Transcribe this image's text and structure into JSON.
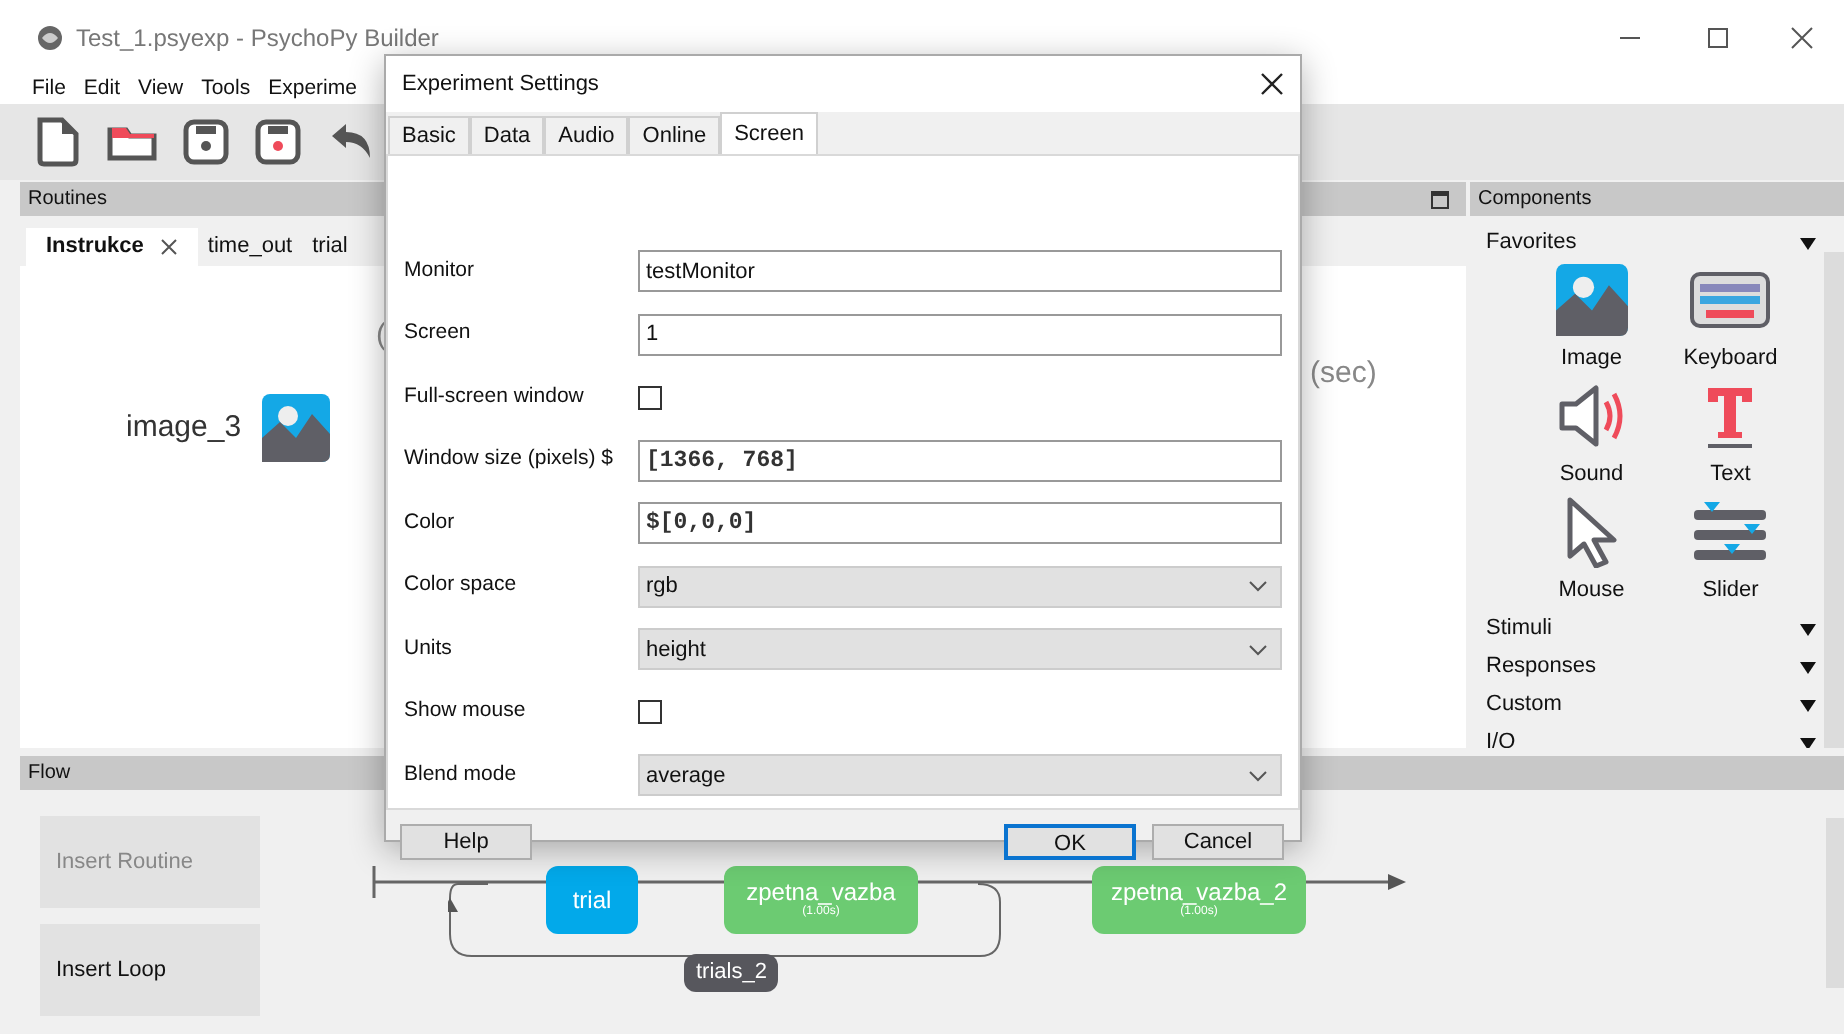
{
  "window": {
    "title": "Test_1.psyexp - PsychoPy Builder"
  },
  "menu": [
    "File",
    "Edit",
    "View",
    "Tools",
    "Experime"
  ],
  "routines": {
    "title": "Routines",
    "tabs": [
      {
        "label": "Instrukce",
        "selected": true
      },
      {
        "label": "time_out",
        "selected": false
      },
      {
        "label": "trial",
        "selected": false
      }
    ],
    "component_label": "image_3",
    "paren": "(",
    "unit": "(sec)"
  },
  "components": {
    "title": "Components",
    "categories": [
      {
        "label": "Favorites",
        "items": [
          {
            "label": "Image",
            "kind": "image"
          },
          {
            "label": "Keyboard",
            "kind": "keyboard"
          },
          {
            "label": "Sound",
            "kind": "sound"
          },
          {
            "label": "Text",
            "kind": "text"
          },
          {
            "label": "Mouse",
            "kind": "mouse"
          },
          {
            "label": "Slider",
            "kind": "slider"
          }
        ]
      },
      {
        "label": "Stimuli"
      },
      {
        "label": "Responses"
      },
      {
        "label": "Custom"
      },
      {
        "label": "I/O"
      }
    ]
  },
  "flow": {
    "title": "Flow",
    "buttons": [
      {
        "label": "Insert Routine",
        "disabled": true
      },
      {
        "label": "Insert Loop",
        "disabled": false
      }
    ],
    "routines": [
      {
        "label": "trial",
        "color": "#02a9ea"
      },
      {
        "label": "zpetna_vazba",
        "duration": "(1.00s)",
        "color": "#6ccb72"
      },
      {
        "label": "zpetna_vazba_2",
        "duration": "(1.00s)",
        "color": "#6ccb72"
      }
    ],
    "loop": {
      "label": "trials_2"
    }
  },
  "dialog": {
    "title": "Experiment Settings",
    "tabs": [
      {
        "label": "Basic",
        "selected": false
      },
      {
        "label": "Data",
        "selected": false
      },
      {
        "label": "Audio",
        "selected": false
      },
      {
        "label": "Online",
        "selected": false
      },
      {
        "label": "Screen",
        "selected": true
      }
    ],
    "fields": [
      {
        "label": "Monitor",
        "kind": "text",
        "value": "testMonitor"
      },
      {
        "label": "Screen",
        "kind": "text",
        "value": "1"
      },
      {
        "label": "Full-screen window",
        "kind": "checkbox",
        "checked": false
      },
      {
        "label": "Window size (pixels) $",
        "kind": "code",
        "value": "[1366, 768]"
      },
      {
        "label": "Color",
        "kind": "code",
        "value": "$[0,0,0]"
      },
      {
        "label": "Color space",
        "kind": "select",
        "value": "rgb"
      },
      {
        "label": "Units",
        "kind": "select",
        "value": "height"
      },
      {
        "label": "Show mouse",
        "kind": "checkbox",
        "checked": false
      },
      {
        "label": "Blend mode",
        "kind": "select",
        "value": "average"
      }
    ],
    "buttons": [
      {
        "label": "Help",
        "default": false
      },
      {
        "label": "OK",
        "default": true
      },
      {
        "label": "Cancel",
        "default": false
      }
    ]
  }
}
